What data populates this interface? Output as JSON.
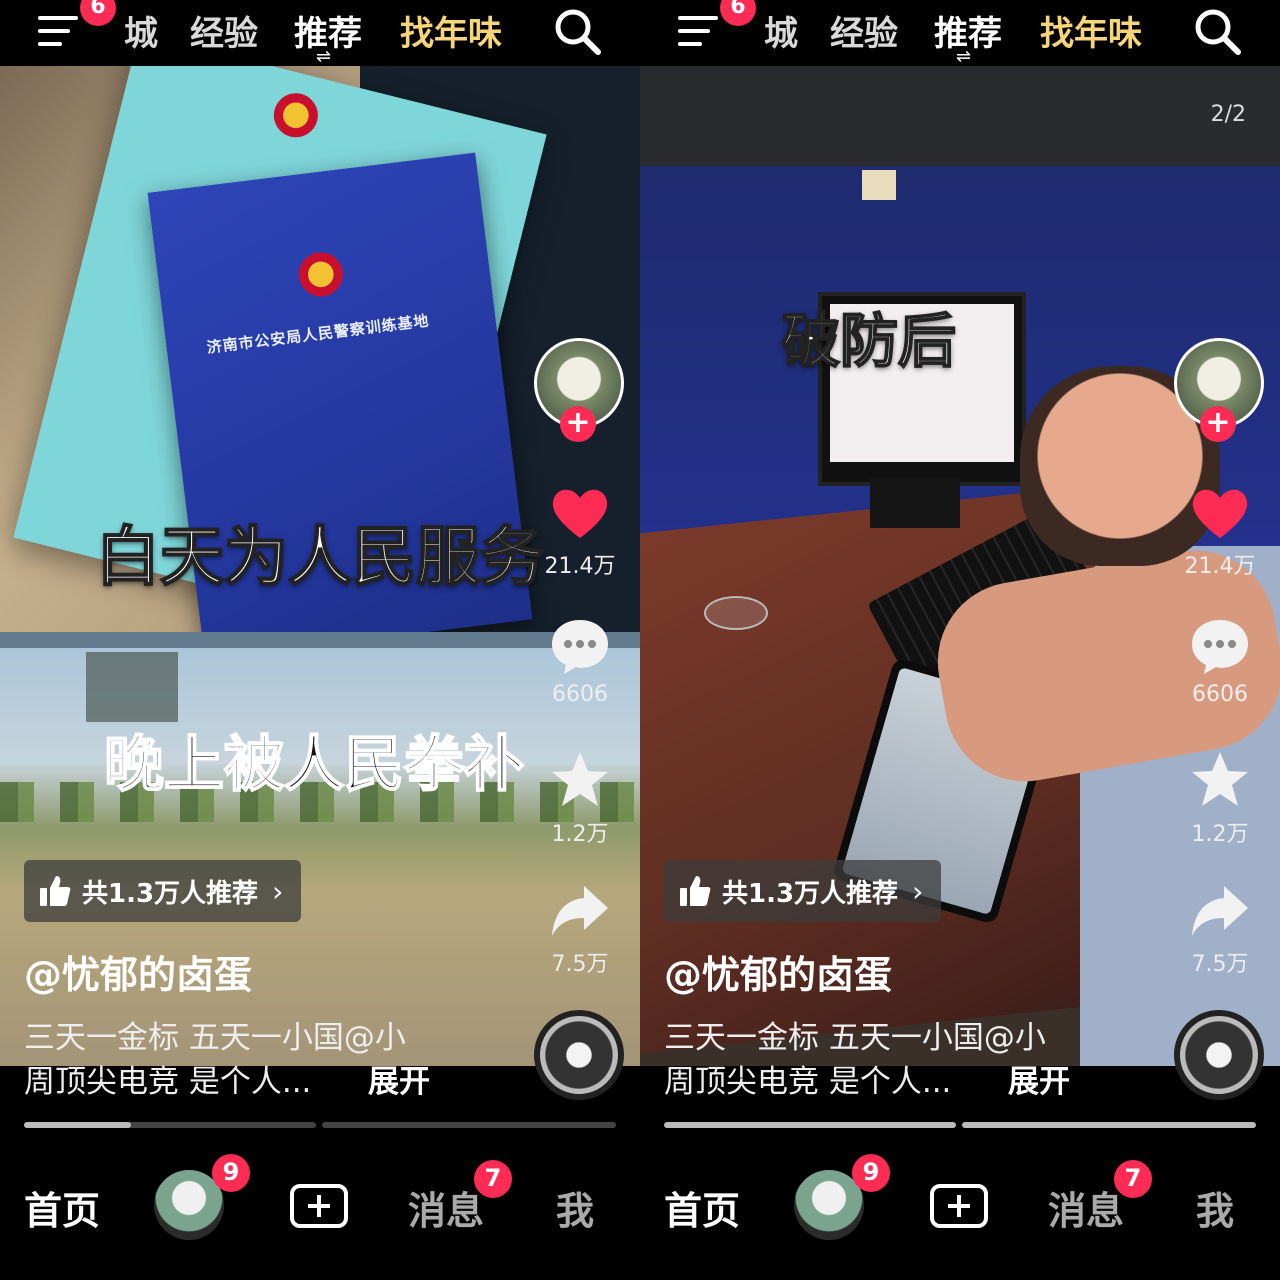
{
  "screens": [
    {
      "topbar": {
        "menu_badge": "6",
        "tabs": [
          "城",
          "经验",
          "推荐",
          "找年味"
        ],
        "tab_swap_glyph": "⇌"
      },
      "captions": {
        "line1": "白天为人民服务",
        "line2": "晚上被人民拳补"
      },
      "book_title": "济南市公安局人民警察训练基地",
      "rail": {
        "likes": "21.4万",
        "comments": "6606",
        "favorites": "1.2万",
        "shares": "7.5万"
      },
      "recommend": {
        "text": "共1.3万人推荐",
        "chevron": "›"
      },
      "author": "@忧郁的卤蛋",
      "description_line1": "三天一金标 五天一小国@小",
      "description_line2": "周顶尖电竞 是个人...",
      "expand_label": "展开",
      "progress_fraction": 0.18,
      "bottom_nav": {
        "home": "首页",
        "avatar_badge": "9",
        "message": "消息",
        "message_badge": "7",
        "me": "我"
      }
    },
    {
      "topbar": {
        "menu_badge": "6",
        "tabs": [
          "城",
          "经验",
          "推荐",
          "找年味"
        ],
        "tab_swap_glyph": "⇌"
      },
      "page_indicator": "2/2",
      "captions": {
        "line1": "破防后"
      },
      "rail": {
        "likes": "21.4万",
        "comments": "6606",
        "favorites": "1.2万",
        "shares": "7.5万"
      },
      "recommend": {
        "text": "共1.3万人推荐",
        "chevron": "›"
      },
      "author": "@忧郁的卤蛋",
      "description_line1": "三天一金标 五天一小国@小",
      "description_line2": "周顶尖电竞 是个人...",
      "expand_label": "展开",
      "bottom_nav": {
        "home": "首页",
        "avatar_badge": "9",
        "message": "消息",
        "message_badge": "7",
        "me": "我"
      }
    }
  ],
  "icons": {
    "menu": "menu-icon",
    "search": "search-icon",
    "like": "heart-icon",
    "comment": "comment-icon",
    "favorite": "star-icon",
    "share": "share-icon",
    "recommend": "thumbs-up-icon",
    "create": "plus-icon"
  },
  "colors": {
    "accent": "#fe2c55",
    "festival_tab": "#f7d67a",
    "background": "#000000"
  }
}
